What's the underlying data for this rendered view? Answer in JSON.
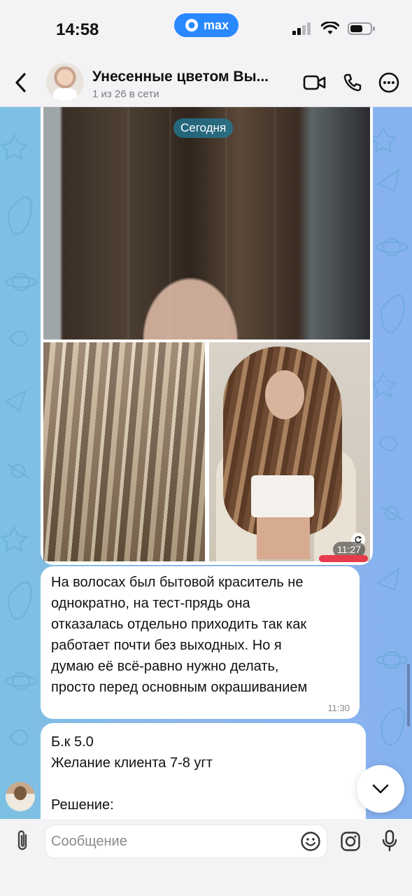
{
  "status_bar": {
    "time": "14:58",
    "carrier_label": "max"
  },
  "header": {
    "chat_title": "Унесенные цветом Вы...",
    "chat_subtitle": "1 из 26 в сети",
    "icons": [
      "back-arrow-icon",
      "video-call-icon",
      "phone-icon",
      "more-icon"
    ]
  },
  "messages": {
    "date_badge": "Сегодня",
    "image_message_time": "11:27",
    "text_message": {
      "text": "На волосах был бытовой краситель не\nоднократно, на тест-прядь она\nотказалась отдельно приходить так как\nработает почти без выходных. Но я\nдумаю её всё-равно нужно делать,\nпросто перед основным окрашиванием",
      "time": "11:30"
    },
    "partial_message": {
      "text": "Б.к 5.0\nЖелание клиента 7-8 угт\n\nРешение:"
    }
  },
  "composer": {
    "placeholder": "Сообщение",
    "icons": [
      "attach-icon",
      "emoji-icon",
      "camera-icon",
      "microphone-icon"
    ]
  },
  "colors": {
    "accent": "#2a88ff",
    "wallpaper_left": "#7cc1e3",
    "wallpaper_right": "#86b2f0"
  }
}
